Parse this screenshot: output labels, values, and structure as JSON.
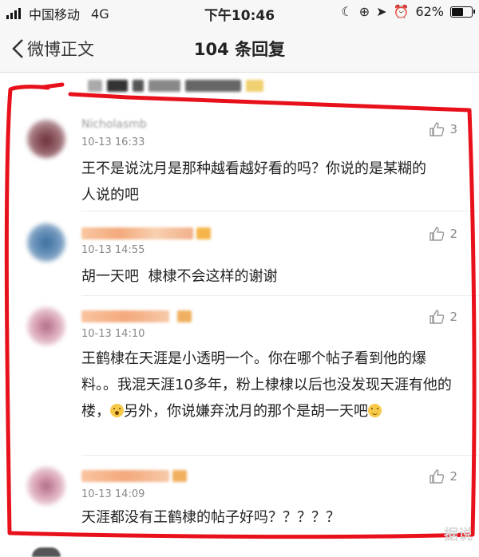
{
  "status_bar": {
    "carrier": "中国移动",
    "network": "4G",
    "time": "下午10:46",
    "battery": "62%",
    "battery_level": 0.62,
    "icons": [
      "moon-icon",
      "rotation-lock-icon",
      "location-icon",
      "alarm-icon",
      "battery-icon"
    ]
  },
  "nav": {
    "back_label": "微博正文",
    "title": "104 条回复"
  },
  "colors": {
    "annotation_red": "#e8101a",
    "time_gray": "#888888",
    "background": "#ffffff"
  },
  "comments": [
    {
      "username": "Nicholasmb",
      "time": "10-13 16:33",
      "likes": "3",
      "text": "王不是说沈月是那种越看越好看的吗？你说的是某糊的人说的吧",
      "avatar_color": "#7a4a52"
    },
    {
      "username": "",
      "time": "10-13 14:55",
      "likes": "2",
      "text": "胡一天吧  棣棣不会这样的谢谢",
      "avatar_color": "#5a7fa8"
    },
    {
      "username": "",
      "time": "10-13 14:10",
      "likes": "2",
      "text_parts": [
        "王鹤棣在天涯是小透明一个。你在哪个帖子看到他的爆料。。我混天涯10多年，粉上棣棣以后也没发现天涯有他的楼，",
        "另外，你说嫌弃沈月的那个是胡一天吧"
      ],
      "avatar_color": "#d9a3b6"
    },
    {
      "username": "",
      "time": "10-13 14:09",
      "likes": "2",
      "text": "天涯都没有王鹤棣的帖子好吗？？？？？",
      "avatar_color": "#d9a3b6"
    }
  ],
  "watermark": "据说"
}
